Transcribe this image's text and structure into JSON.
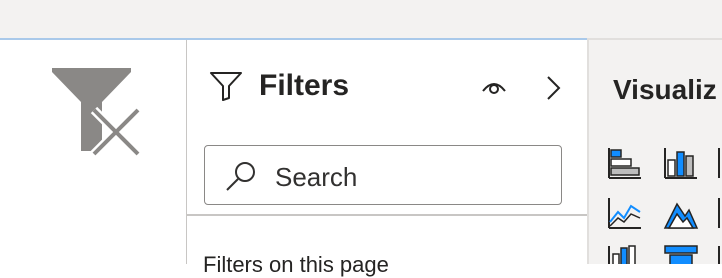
{
  "filters": {
    "title": "Filters",
    "search_placeholder": "Search",
    "section_label": "Filters on this page"
  },
  "visualizations": {
    "title": "Visualiz"
  },
  "icons": {
    "clear_filter": "filter-clear-icon",
    "filter": "filter-icon",
    "eye": "eye-icon",
    "chevron": "chevron-right-icon",
    "search": "search-icon"
  },
  "colors": {
    "accent_blue": "#118dff",
    "icon_gray": "#605e5c"
  }
}
